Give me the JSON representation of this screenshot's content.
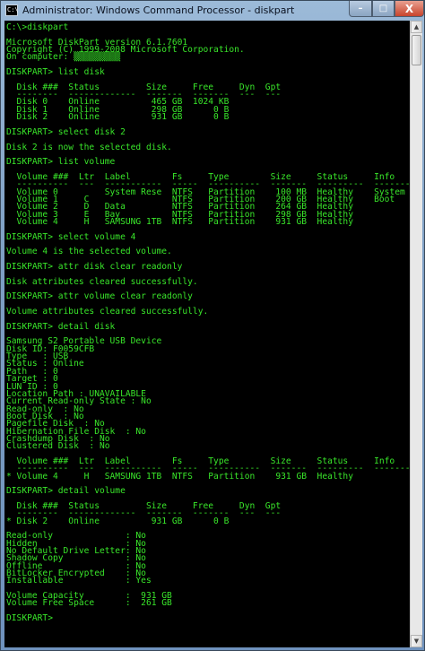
{
  "window": {
    "title": "Administrator: Windows Command Processor - diskpart",
    "icon_label": "C:\\",
    "minimize_glyph": "–",
    "maximize_glyph": "□",
    "close_glyph": "X"
  },
  "scrollbar": {
    "up_glyph": "▲",
    "down_glyph": "▼"
  },
  "colors": {
    "console_background": "#000000",
    "console_text": "#39e62a",
    "close_button": "#c8442c"
  },
  "console": {
    "lines": [
      "C:\\>diskpart",
      "",
      "Microsoft DiskPart version 6.1.7601",
      "Copyright (C) 1999-2008 Microsoft Corporation.",
      "On computer: ▒▒▒▒▒▒▒▒▒",
      "",
      "DISKPART> list disk",
      "",
      "  Disk ###  Status         Size     Free     Dyn  Gpt",
      "  --------  -------------  -------  -------  ---  ---",
      "  Disk 0    Online          465 GB  1024 KB",
      "  Disk 1    Online          298 GB      0 B",
      "  Disk 2    Online          931 GB      0 B",
      "",
      "DISKPART> select disk 2",
      "",
      "Disk 2 is now the selected disk.",
      "",
      "DISKPART> list volume",
      "",
      "  Volume ###  Ltr  Label        Fs     Type        Size     Status     Info",
      "  ----------  ---  -----------  -----  ----------  -------  ---------  --------",
      "  Volume 0         System Rese  NTFS   Partition    100 MB  Healthy    System",
      "  Volume 1     C                NTFS   Partition    200 GB  Healthy    Boot",
      "  Volume 2     D   Data         NTFS   Partition    264 GB  Healthy",
      "  Volume 3     E   Bay          NTFS   Partition    298 GB  Healthy",
      "  Volume 4     H   SAMSUNG 1TB  NTFS   Partition    931 GB  Healthy",
      "",
      "DISKPART> select volume 4",
      "",
      "Volume 4 is the selected volume.",
      "",
      "DISKPART> attr disk clear readonly",
      "",
      "Disk attributes cleared successfully.",
      "",
      "DISKPART> attr volume clear readonly",
      "",
      "Volume attributes cleared successfully.",
      "",
      "DISKPART> detail disk",
      "",
      "Samsung S2 Portable USB Device",
      "Disk ID: F0059CFB",
      "Type   : USB",
      "Status : Online",
      "Path   : 0",
      "Target : 0",
      "LUN ID : 0",
      "Location Path : UNAVAILABLE",
      "Current Read-only State : No",
      "Read-only  : No",
      "Boot Disk  : No",
      "Pagefile Disk  : No",
      "Hibernation File Disk  : No",
      "Crashdump Disk  : No",
      "Clustered Disk  : No",
      "",
      "  Volume ###  Ltr  Label        Fs     Type        Size     Status     Info",
      "  ----------  ---  -----------  -----  ----------  -------  ---------  --------",
      "* Volume 4     H   SAMSUNG 1TB  NTFS   Partition    931 GB  Healthy",
      "",
      "DISKPART> detail volume",
      "",
      "  Disk ###  Status         Size     Free     Dyn  Gpt",
      "  --------  -------------  -------  -------  ---  ---",
      "* Disk 2    Online          931 GB      0 B",
      "",
      "Read-only              : No",
      "Hidden                 : No",
      "No Default Drive Letter: No",
      "Shadow Copy            : No",
      "Offline                : No",
      "BitLocker Encrypted    : No",
      "Installable            : Yes",
      "",
      "Volume Capacity        :  931 GB",
      "Volume Free Space      :  261 GB",
      "",
      "DISKPART>"
    ]
  }
}
